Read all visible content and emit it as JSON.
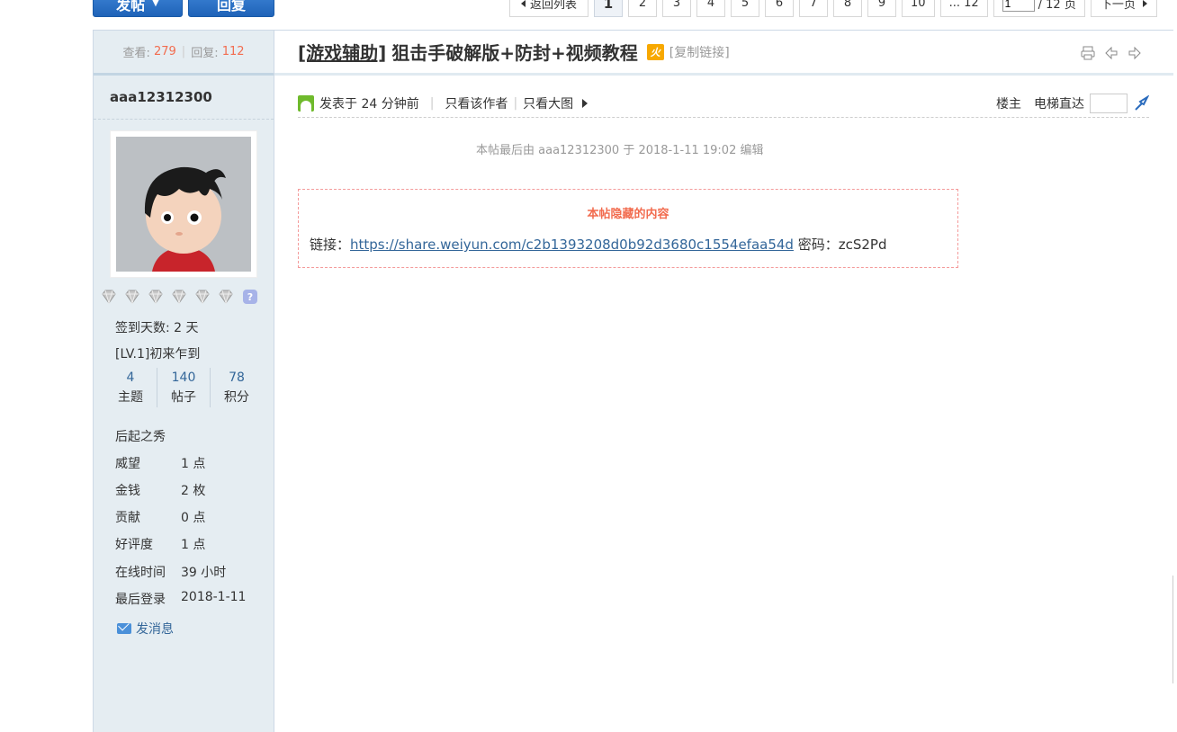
{
  "top_buttons": {
    "post": "发帖",
    "reply": "回复"
  },
  "pager": {
    "back": "返回列表",
    "pages": [
      "1",
      "2",
      "3",
      "4",
      "5",
      "6",
      "7",
      "8",
      "9",
      "10"
    ],
    "current": "1",
    "last": "... 12",
    "input_value": "1",
    "total": "/ 12 页",
    "next": "下一页"
  },
  "stats": {
    "views_label": "查看:",
    "views": "279",
    "replies_label": "回复:",
    "replies": "112"
  },
  "author": {
    "name": "aaa12312300",
    "checkin": "签到天数: 2 天",
    "level": "[LV.1]初来乍到",
    "counts": [
      {
        "num": "4",
        "label": "主题"
      },
      {
        "num": "140",
        "label": "帖子"
      },
      {
        "num": "78",
        "label": "积分"
      }
    ],
    "group": "后起之秀",
    "profile": [
      {
        "k": "威望",
        "v": "1 点"
      },
      {
        "k": "金钱",
        "v": "2 枚"
      },
      {
        "k": "贡献",
        "v": "0 点"
      },
      {
        "k": "好评度",
        "v": "1 点"
      },
      {
        "k": "在线时间",
        "v": "39 小时"
      },
      {
        "k": "最后登录",
        "v": "2018-1-11"
      }
    ],
    "send_message": "发消息"
  },
  "thread": {
    "category": "[游戏辅助]",
    "title": "狙击手破解版+防封+视频教程",
    "hot_badge": "火",
    "copy_link": "[复制链接]"
  },
  "meta": {
    "posted": "发表于 24 分钟前",
    "only_author": "只看该作者",
    "only_images": "只看大图",
    "floor": "楼主",
    "elevator": "电梯直达"
  },
  "edit_note": "本帖最后由 aaa12312300 于 2018-1-11 19:02 编辑",
  "hidden": {
    "title": "本帖隐藏的内容",
    "link_label": "链接：",
    "link_url": "https://share.weiyun.com/c2b1393208d0b92d3680c1554efaa54d",
    "password_label": "密码：",
    "password": "zcS2Pd"
  },
  "colors": {
    "accent": "#1f63b8",
    "highlight": "#f26c4f",
    "link": "#336699",
    "sidebar": "#e5edf2"
  }
}
